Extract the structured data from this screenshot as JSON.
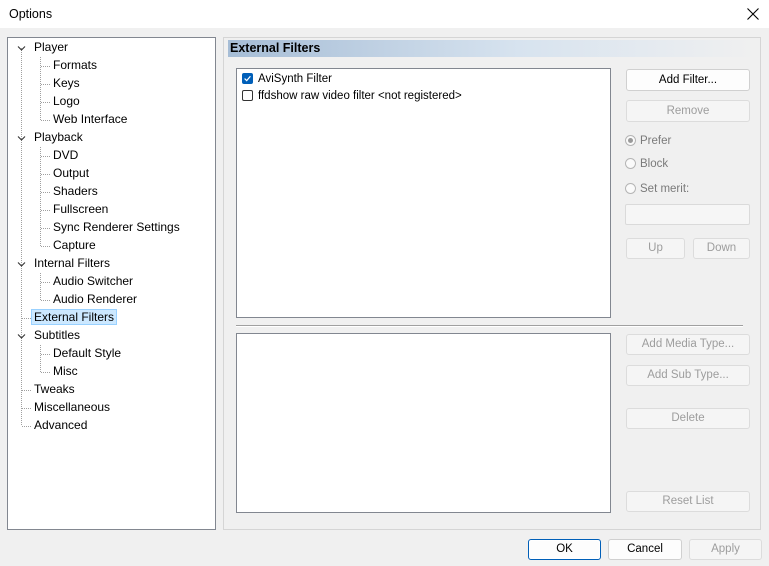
{
  "window": {
    "title": "Options"
  },
  "tree": {
    "items": [
      {
        "label": "Player",
        "level": 0,
        "expanded": true
      },
      {
        "label": "Formats",
        "level": 1
      },
      {
        "label": "Keys",
        "level": 1
      },
      {
        "label": "Logo",
        "level": 1
      },
      {
        "label": "Web Interface",
        "level": 1
      },
      {
        "label": "Playback",
        "level": 0,
        "expanded": true
      },
      {
        "label": "DVD",
        "level": 1
      },
      {
        "label": "Output",
        "level": 1
      },
      {
        "label": "Shaders",
        "level": 1
      },
      {
        "label": "Fullscreen",
        "level": 1
      },
      {
        "label": "Sync Renderer Settings",
        "level": 1
      },
      {
        "label": "Capture",
        "level": 1
      },
      {
        "label": "Internal Filters",
        "level": 0,
        "expanded": true
      },
      {
        "label": "Audio Switcher",
        "level": 1
      },
      {
        "label": "Audio Renderer",
        "level": 1
      },
      {
        "label": "External Filters",
        "level": 0,
        "selected": true
      },
      {
        "label": "Subtitles",
        "level": 0,
        "expanded": true
      },
      {
        "label": "Default Style",
        "level": 1
      },
      {
        "label": "Misc",
        "level": 1
      },
      {
        "label": "Tweaks",
        "level": 0
      },
      {
        "label": "Miscellaneous",
        "level": 0
      },
      {
        "label": "Advanced",
        "level": 0
      }
    ]
  },
  "panel": {
    "header": "External Filters",
    "filters": [
      {
        "label": "AviSynth Filter",
        "checked": true
      },
      {
        "label": "ffdshow raw video filter <not registered>",
        "checked": false
      }
    ],
    "buttons": {
      "add_filter": "Add Filter...",
      "remove": "Remove",
      "up": "Up",
      "down": "Down",
      "add_media_type": "Add Media Type...",
      "add_sub_type": "Add Sub Type...",
      "delete": "Delete",
      "reset_list": "Reset List"
    },
    "merit": {
      "prefer": "Prefer",
      "block": "Block",
      "set_merit": "Set merit:",
      "selected": "prefer",
      "value": ""
    }
  },
  "footer": {
    "ok": "OK",
    "cancel": "Cancel",
    "apply": "Apply"
  },
  "colors": {
    "accent": "#005fb8",
    "selection": "#cce8ff",
    "disabled_text": "#9d9d9d"
  }
}
